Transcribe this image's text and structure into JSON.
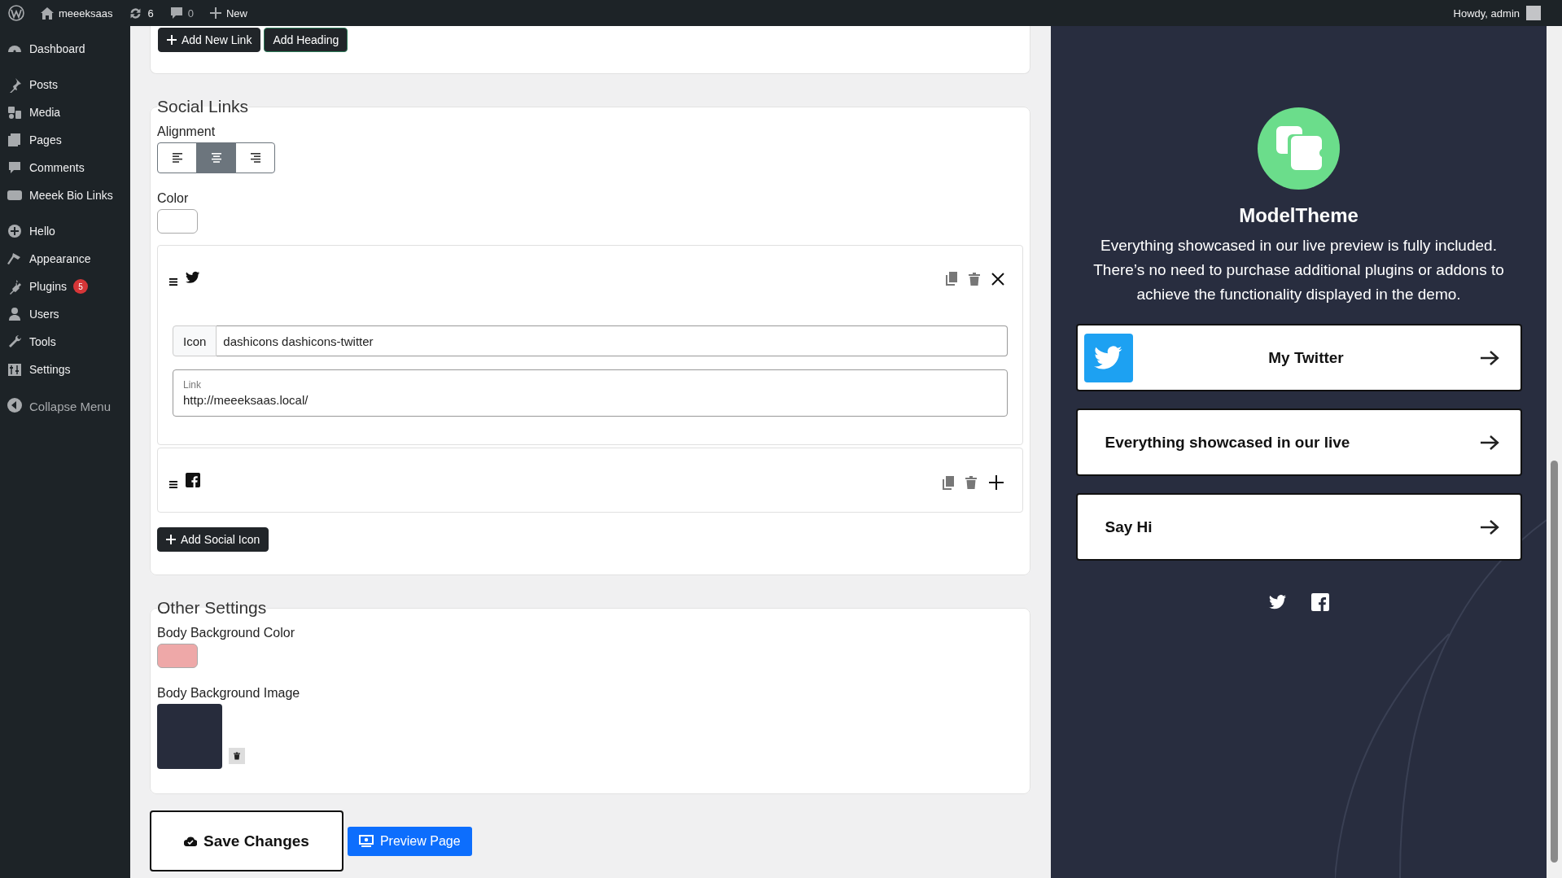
{
  "admin_bar": {
    "site": "meeeksaas",
    "updates": "6",
    "comments": "0",
    "new": "New",
    "greeting": "Howdy, admin"
  },
  "sidebar": {
    "groups": [
      {
        "items": [
          {
            "label": "Dashboard"
          }
        ]
      },
      {
        "items": [
          {
            "label": "Posts"
          },
          {
            "label": "Media"
          },
          {
            "label": "Pages"
          },
          {
            "label": "Comments"
          },
          {
            "label": "Meeek Bio Links"
          }
        ]
      },
      {
        "items": [
          {
            "label": "Hello"
          },
          {
            "label": "Appearance"
          },
          {
            "label": "Plugins",
            "badge": "5"
          },
          {
            "label": "Users"
          },
          {
            "label": "Tools"
          },
          {
            "label": "Settings"
          }
        ]
      }
    ],
    "collapse": "Collapse Menu"
  },
  "top_card": {
    "buttons": [
      {
        "label": "Add New Link",
        "kind": "add"
      },
      {
        "label": "Add Heading",
        "kind": "plain"
      }
    ]
  },
  "social_links": {
    "title": "Social Links",
    "alignment_label": "Alignment",
    "alignment_options": [
      {
        "kind": "left",
        "selected": false
      },
      {
        "kind": "center",
        "selected": true
      },
      {
        "kind": "right",
        "selected": false
      }
    ],
    "color_label": "Color",
    "items": [
      {
        "kind": "twitter",
        "expanded": true,
        "icon_field": {
          "addon": "Icon",
          "value": "dashicons dashicons-twitter"
        },
        "link_field": {
          "label": "Link",
          "value": "http://meeeksaas.local/"
        }
      },
      {
        "kind": "facebook",
        "expanded": false
      }
    ],
    "add_button": "Add Social Icon"
  },
  "other_settings": {
    "title": "Other Settings",
    "bg_color_label": "Body Background Color",
    "bg_image_label": "Body Background Image"
  },
  "actions": {
    "save": "Save Changes",
    "preview": "Preview Page"
  },
  "preview": {
    "title": "ModelTheme",
    "description": "Everything showcased in our live preview is fully included. There’s no need to purchase additional plugins or addons to achieve the functionality displayed in the demo.",
    "links": [
      {
        "label": "My Twitter",
        "kind": "twitter"
      },
      {
        "label": "Everything showcased in our live",
        "kind": "plain"
      },
      {
        "label": "Say Hi",
        "kind": "plain"
      }
    ],
    "social_icons": [
      {
        "kind": "twitter"
      },
      {
        "kind": "facebook"
      }
    ]
  }
}
